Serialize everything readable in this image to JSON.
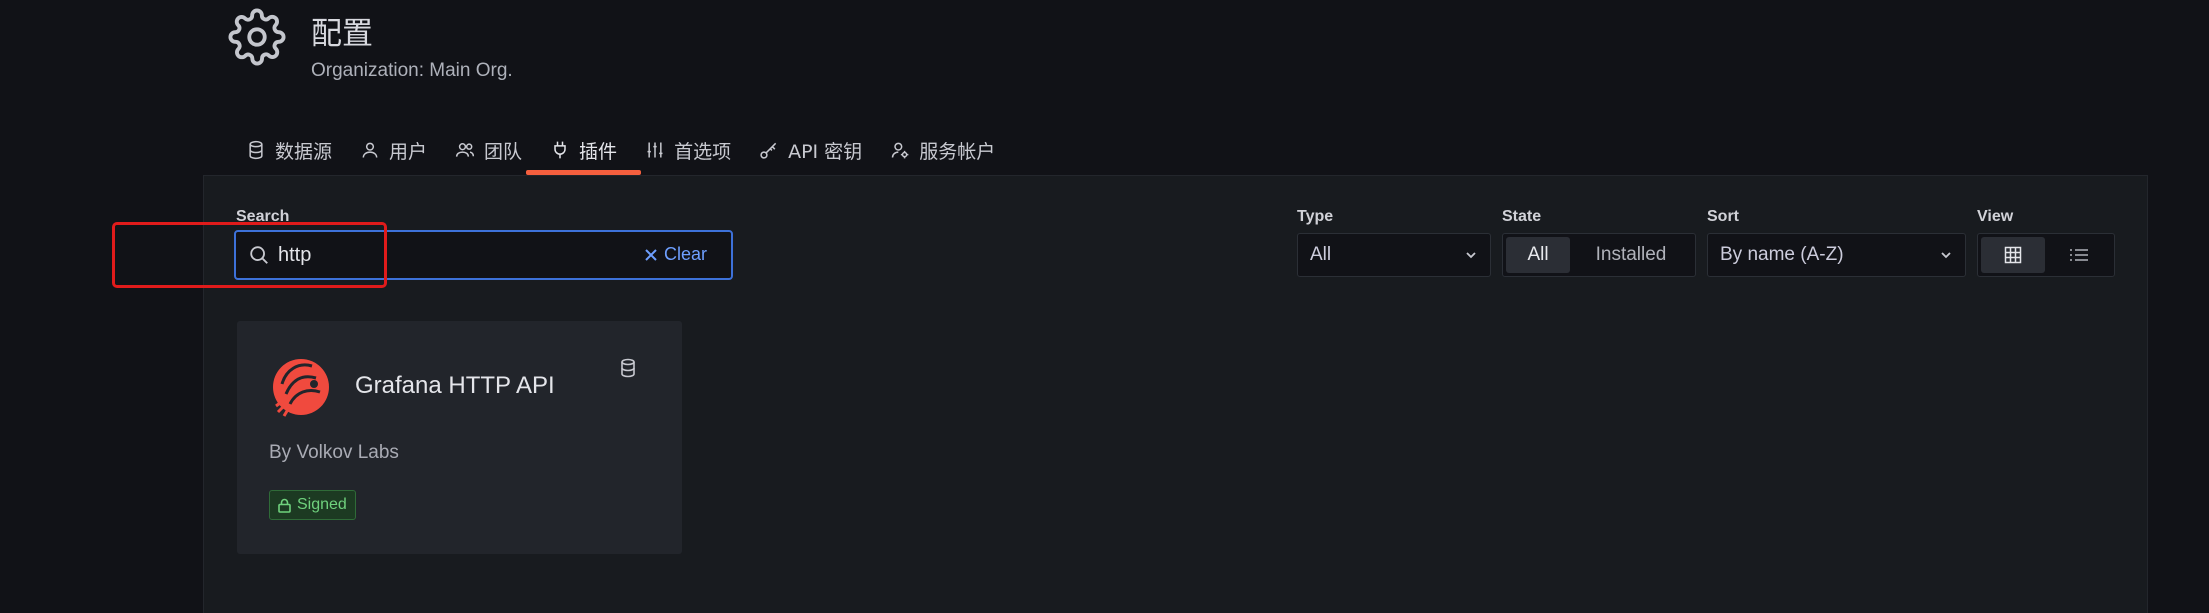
{
  "header": {
    "title": "配置",
    "subtitle": "Organization: Main Org."
  },
  "tabs": [
    {
      "label": "数据源",
      "icon": "database-icon"
    },
    {
      "label": "用户",
      "icon": "user-icon"
    },
    {
      "label": "团队",
      "icon": "users-icon"
    },
    {
      "label": "插件",
      "icon": "plug-icon",
      "active": true
    },
    {
      "label": "首选项",
      "icon": "sliders-icon"
    },
    {
      "label": "API 密钥",
      "icon": "key-icon"
    },
    {
      "label": "服务帐户",
      "icon": "user-cog-icon"
    }
  ],
  "filters": {
    "search_label": "Search",
    "search_value": "http",
    "clear_label": "Clear",
    "type_label": "Type",
    "type_value": "All",
    "state_label": "State",
    "state_options": [
      "All",
      "Installed"
    ],
    "state_selected": "All",
    "sort_label": "Sort",
    "sort_value": "By name (A-Z)",
    "view_label": "View",
    "view_selected": "grid"
  },
  "plugin_card": {
    "name": "Grafana HTTP API",
    "author": "By Volkov Labs",
    "badge": "Signed",
    "type_icon": "database-icon"
  },
  "colors": {
    "accent_tab": "#f55f3e",
    "focus_border": "#3d71d9",
    "highlight_box": "#e01b1b",
    "signed_green": "#6fd17d"
  }
}
